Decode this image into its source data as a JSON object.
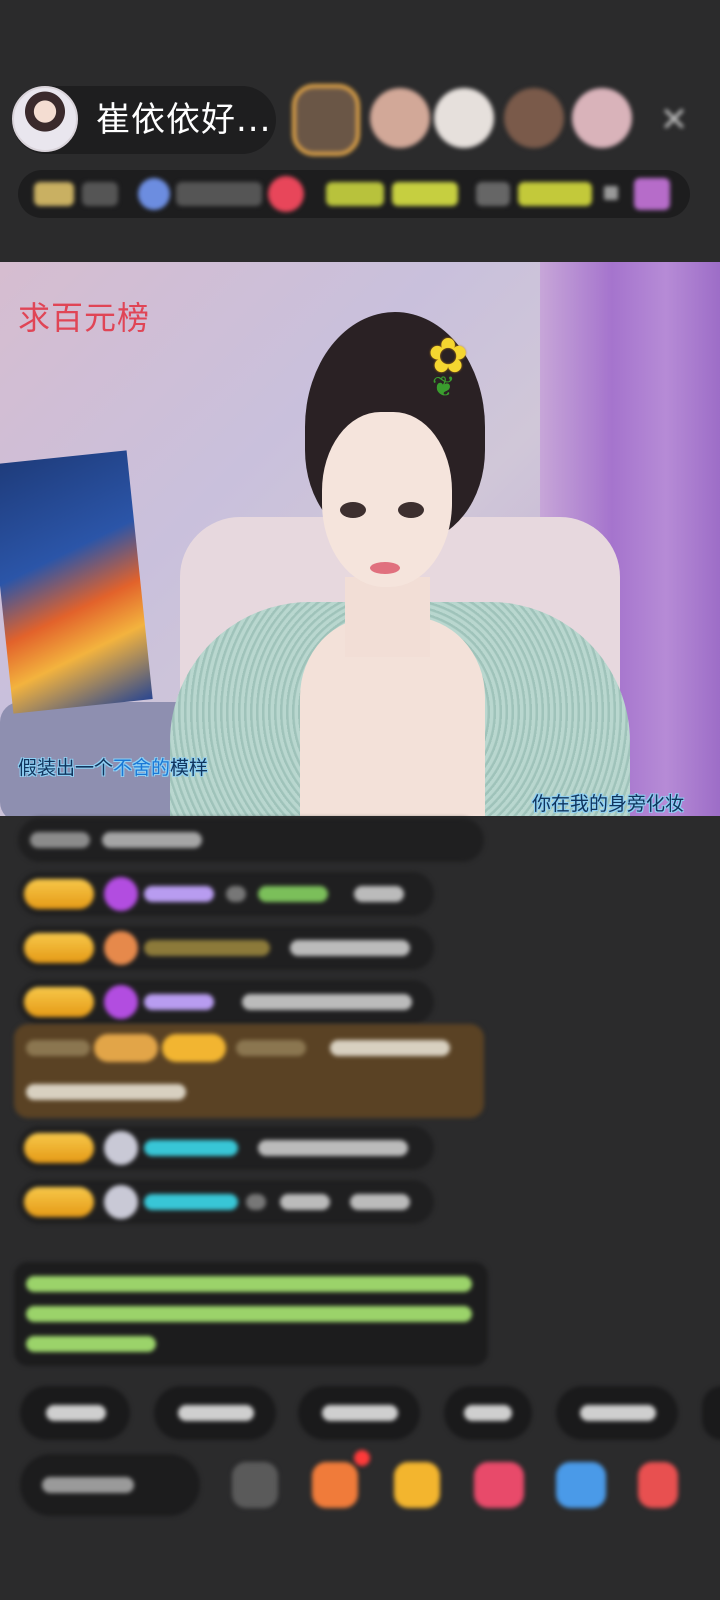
{
  "host": {
    "name": "崔依依好...",
    "close_icon": "close-icon"
  },
  "video": {
    "title": "求百元榜",
    "lyric_left": {
      "before": "假装出一个",
      "highlight": "不舍的",
      "after": "模样"
    },
    "lyric_right": "你在我的身旁化妆"
  },
  "colors": {
    "background": "#2b2b2c",
    "badge_gold": "#f2b531",
    "title_red": "#e04556",
    "notice_green": "#9bd36a",
    "name_purple": "#c9a7ff",
    "name_cyan": "#38c6d6",
    "system_brown": "#5a4224"
  },
  "icons": {
    "gift": "gift-icon",
    "more": "more-icon"
  }
}
